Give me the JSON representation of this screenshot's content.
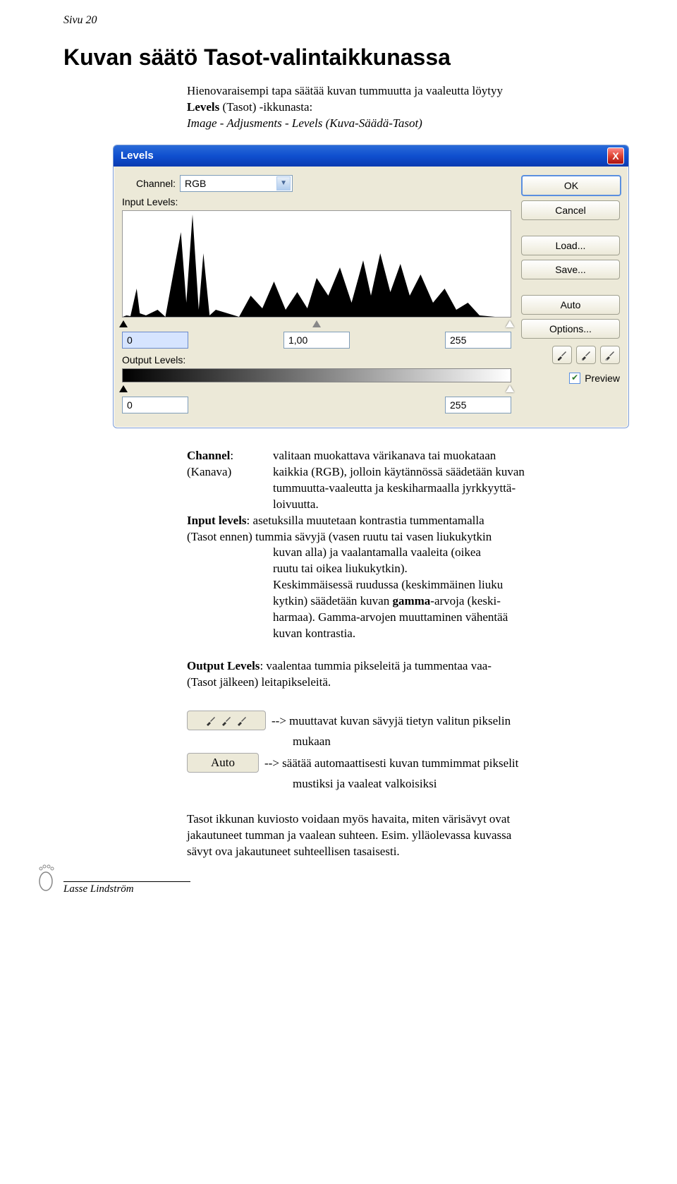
{
  "page_header": "Sivu 20",
  "h1": "Kuvan säätö Tasot-valintaikkunassa",
  "intro_line1": "Hienovaraisempi tapa säätää kuvan tummuutta ja vaaleutta löytyy",
  "intro_bold": "Levels",
  "intro_paren": " (Tasot) -ikkunasta:",
  "intro_line2": "Image - Adjusments - Levels (Kuva-Säädä-Tasot)",
  "dialog": {
    "title": "Levels",
    "close_x": "X",
    "channel_label": "Channel:",
    "channel_value": "RGB",
    "input_levels_label": "Input Levels:",
    "output_levels_label": "Output Levels:",
    "in_low": "0",
    "in_mid": "1,00",
    "in_high": "255",
    "out_low": "0",
    "out_high": "255",
    "btn_ok": "OK",
    "btn_cancel": "Cancel",
    "btn_load": "Load...",
    "btn_save": "Save...",
    "btn_auto": "Auto",
    "btn_options": "Options...",
    "preview_label": "Preview",
    "check": "✔"
  },
  "defs": {
    "channel_term": "Channel",
    "channel_paren": "(Kanava)",
    "channel_desc1": "valitaan muokattava värikanava tai muokataan",
    "channel_desc2": "kaikkia (RGB), jolloin käytännössä säädetään kuvan",
    "channel_desc3": "tummuutta-vaaleutta ja keskiharmaalla jyrkkyyttä-",
    "channel_desc4": "loivuutta.",
    "input_term": "Input levels",
    "input_paren": "(Tasot ennen)",
    "input_desc1": ": asetuksilla muutetaan kontrastia tummentamalla",
    "input_desc2": " tummia sävyjä (vasen ruutu tai vasen liukukytkin",
    "input_desc3": "kuvan alla) ja vaalantamalla vaaleita  (oikea",
    "input_desc4": "ruutu tai oikea liukukytkin).",
    "input_desc5": "Keskimmäisessä ruudussa (keskimmäinen liuku",
    "input_desc6a": "kytkin) säädetään kuvan ",
    "input_desc6b": "gamma",
    "input_desc6c": "-arvoja (keski-",
    "input_desc7": "harmaa). Gamma-arvojen muuttaminen vähentää",
    "input_desc8": "kuvan kontrastia.",
    "output_term": "Output Levels",
    "output_desc1": ": vaalentaa tummia pikseleitä ja tummentaa vaa-",
    "output_paren": "(Tasot jälkeen)",
    "output_desc2": "  leitapikseleitä."
  },
  "arrows": {
    "pip_line": "--> muuttavat kuvan sävyjä tietyn valitun pikselin",
    "pip_line2": "mukaan",
    "auto_line1": "--> säätää automaattisesti kuvan tummimmat pikselit",
    "auto_line2": "mustiksi ja vaaleat valkoisiksi",
    "auto_label": "Auto"
  },
  "closing1": "Tasot ikkunan kuviosto voidaan myös havaita, miten värisävyt ovat",
  "closing2": "jakautuneet tumman ja vaalean suhteen. Esim. ylläolevassa kuvassa",
  "closing3": "sävyt ova jakautuneet suhteellisen tasaisesti.",
  "footer": "Lasse Lindström"
}
